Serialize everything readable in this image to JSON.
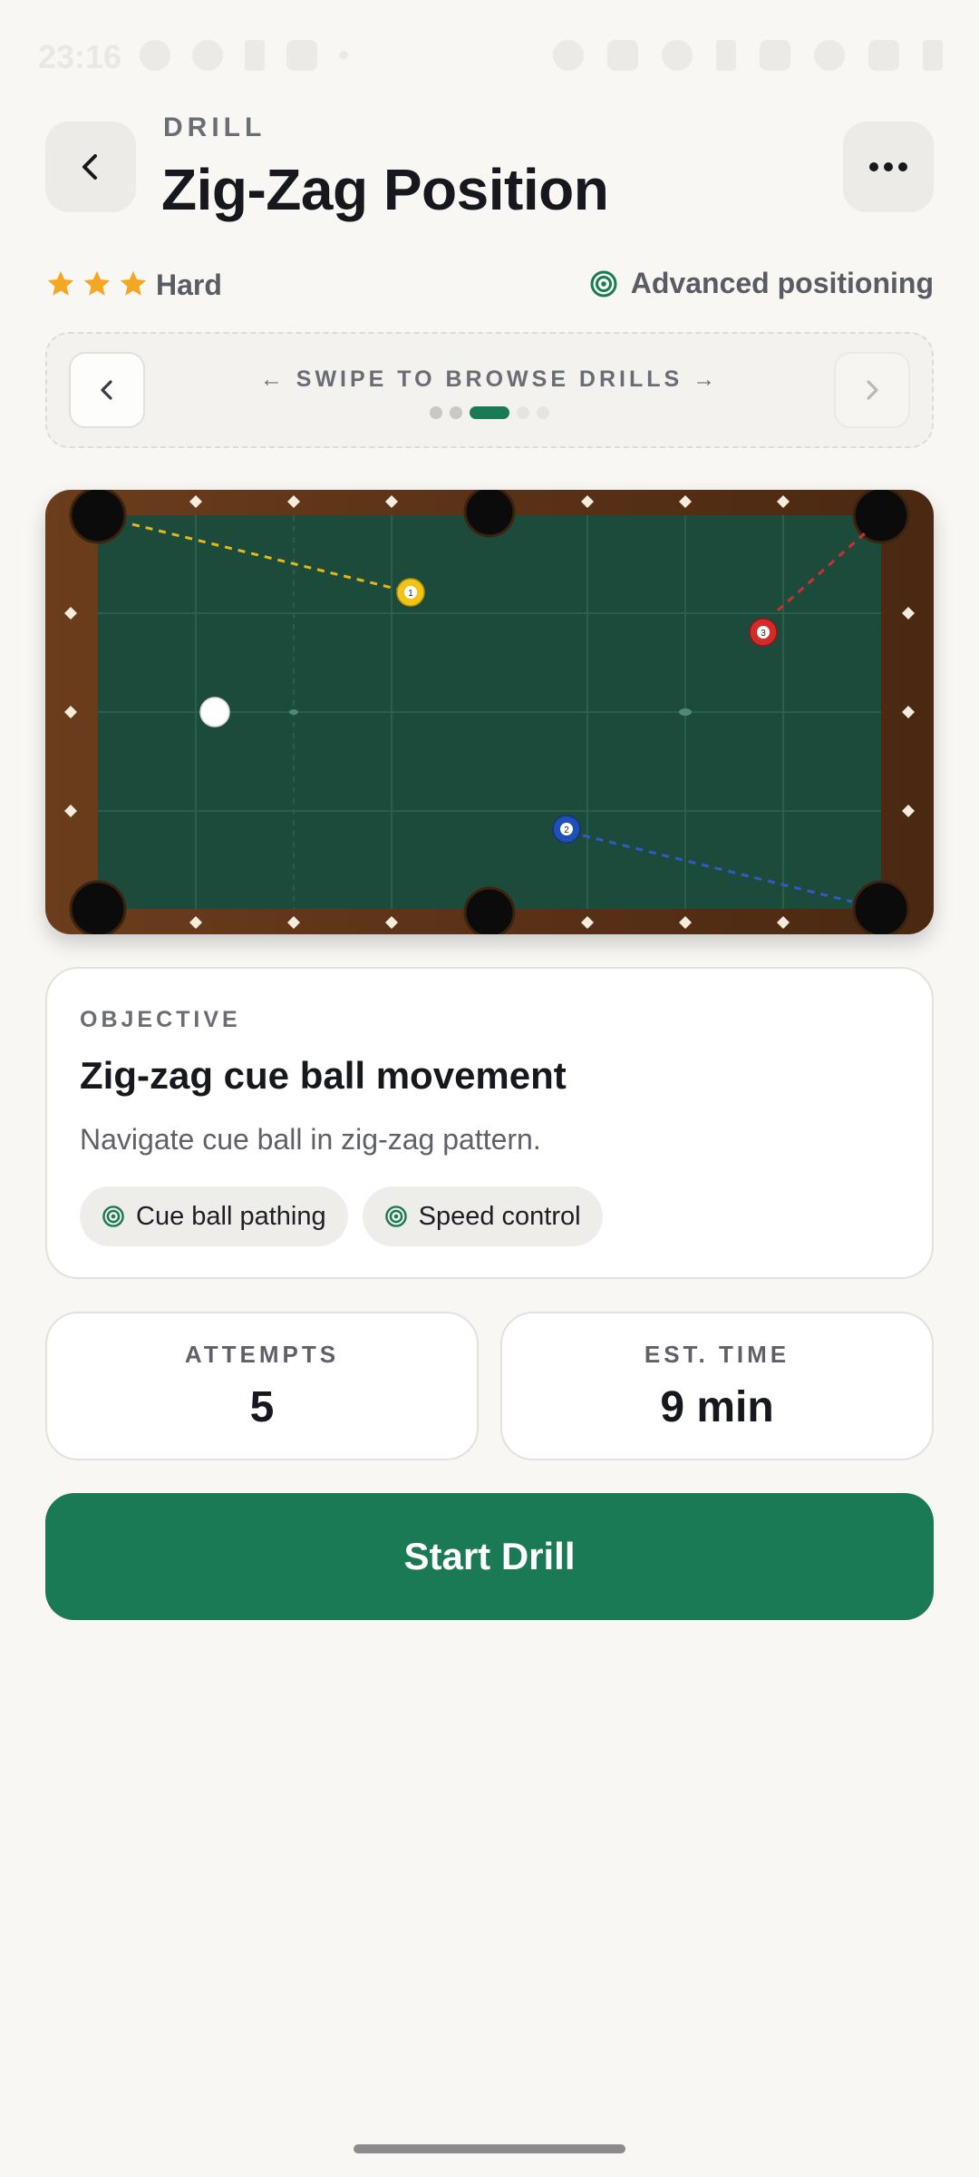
{
  "status_bar": {
    "time": "23:16"
  },
  "header": {
    "eyebrow": "DRILL",
    "title": "Zig-Zag Position",
    "back_icon": "chevron-left-icon",
    "more_icon": "more-horizontal-icon"
  },
  "meta": {
    "stars": 3,
    "difficulty": "Hard",
    "category": "Advanced positioning",
    "category_icon": "target-icon",
    "star_color": "#f5a623"
  },
  "browser": {
    "label": "SWIPE TO BROWSE DRILLS",
    "left_arrow": "←",
    "right_arrow": "→",
    "page_count": 5,
    "active_page": 3
  },
  "table": {
    "felt_color": "#1c4b3c",
    "rail_color": "#5e3519",
    "balls": [
      {
        "label": "1",
        "color": "#f2c418"
      },
      {
        "label": "2",
        "color": "#1f4fb8"
      },
      {
        "label": "3",
        "color": "#d42a2a"
      },
      {
        "label": "cue",
        "color": "#ffffff"
      }
    ]
  },
  "objective": {
    "eyebrow": "OBJECTIVE",
    "title": "Zig-zag cue ball movement",
    "description": "Navigate cue ball in zig-zag pattern.",
    "tags": [
      {
        "label": "Cue ball pathing",
        "icon": "target-icon"
      },
      {
        "label": "Speed control",
        "icon": "target-icon"
      }
    ]
  },
  "stats": {
    "attempts_label": "ATTEMPTS",
    "attempts_value": "5",
    "time_label": "EST. TIME",
    "time_value": "9 min"
  },
  "cta": {
    "label": "Start Drill",
    "color": "#1b7a56"
  }
}
